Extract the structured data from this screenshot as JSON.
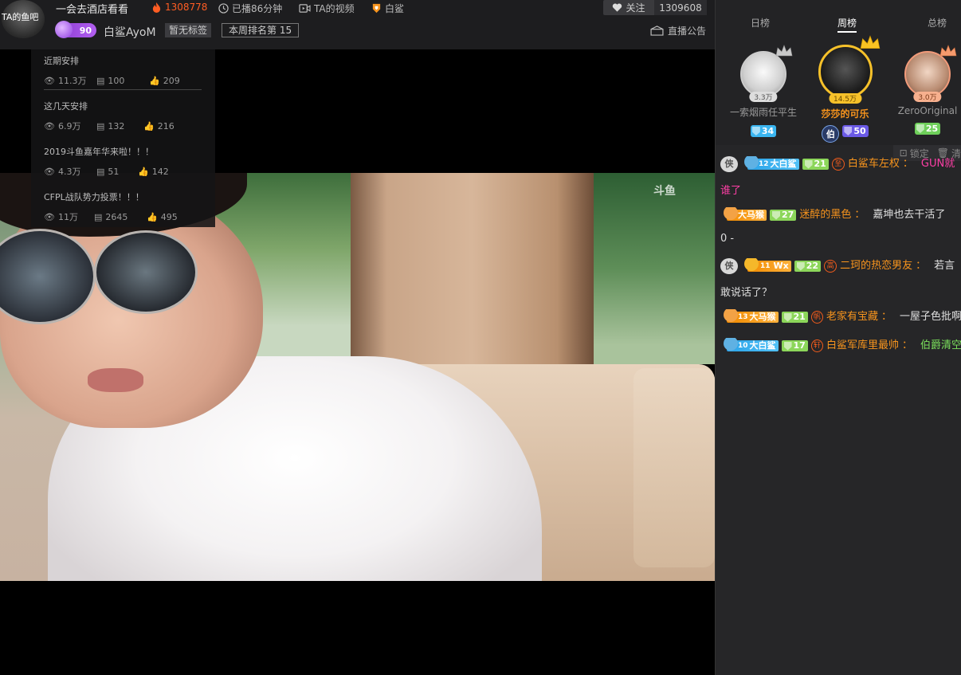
{
  "header": {
    "avatar_label": "TA的鱼吧",
    "title": "一会去酒店看看",
    "hot_count": "1308778",
    "live_duration": "已播86分钟",
    "ta_videos": "TA的视频",
    "shark_label": "白鲨",
    "follow_label": "关注",
    "follow_count": "1309608",
    "level": "90",
    "streamer_name": "白鲨AyoM",
    "tag": "暂无标签",
    "weekly_rank": "本周排名第 15",
    "announcement": "直播公告"
  },
  "playlist": [
    {
      "title": "近期安排",
      "views": "11.3万",
      "comments": "100",
      "likes": "209"
    },
    {
      "title": "这几天安排",
      "views": "6.9万",
      "comments": "132",
      "likes": "216"
    },
    {
      "title": "2019斗鱼嘉年华来啦！！！",
      "views": "4.3万",
      "comments": "51",
      "likes": "142"
    },
    {
      "title": "CFPL战队势力投票！！！",
      "views": "11万",
      "comments": "2645",
      "likes": "495"
    }
  ],
  "video": {
    "watermark": "斗鱼"
  },
  "ranking": {
    "tabs": [
      "日榜",
      "周榜",
      "总榜"
    ],
    "active_tab": "周榜",
    "users": [
      {
        "name": "一索烟雨任平生",
        "score": "3.3万",
        "level": "34",
        "crown": "silver"
      },
      {
        "name": "莎莎的可乐",
        "score": "14.5万",
        "noble": "伯",
        "level": "50",
        "crown": "gold"
      },
      {
        "name": "ZeroOriginal",
        "score": "3.0万",
        "level": "25",
        "crown": "bronze"
      }
    ]
  },
  "chat_tools": {
    "lock": "锁定",
    "clear": "清"
  },
  "chat": [
    {
      "noble": "侠",
      "fan_level": "12",
      "fan_name": "大白鲨",
      "fan_color": "blue",
      "level": "21",
      "rank": "至",
      "user": "白鲨车左权",
      "text": "GUN就",
      "text_color": "pink",
      "continuation": "谁了"
    },
    {
      "noble": "",
      "fan_level": "",
      "fan_name": "大马猴",
      "fan_color": "orange",
      "level": "27",
      "rank": "",
      "user": "迷醉的黑色",
      "text": "嘉坤也去干活了",
      "text_color": "normal",
      "continuation": "0 -"
    },
    {
      "noble": "侠",
      "fan_level": "11",
      "fan_name": "Wx",
      "fan_color": "orange",
      "level": "22",
      "rank": "高",
      "user": "二珂的热恋男友",
      "text": "若言",
      "text_color": "normal",
      "continuation": "敢说话了？"
    },
    {
      "noble": "",
      "fan_level": "13",
      "fan_name": "大马猴",
      "fan_color": "orange",
      "level": "21",
      "rank": "帆",
      "user": "老家有宝藏",
      "text": "一屋子色批啊",
      "text_color": "normal",
      "continuation": ""
    },
    {
      "noble": "",
      "fan_level": "10",
      "fan_name": "大白鲨",
      "fan_color": "blue",
      "level": "17",
      "rank": "轩",
      "user": "白鲨军库里最帅",
      "text": "伯爵清空",
      "text_color": "green",
      "continuation": ""
    }
  ]
}
